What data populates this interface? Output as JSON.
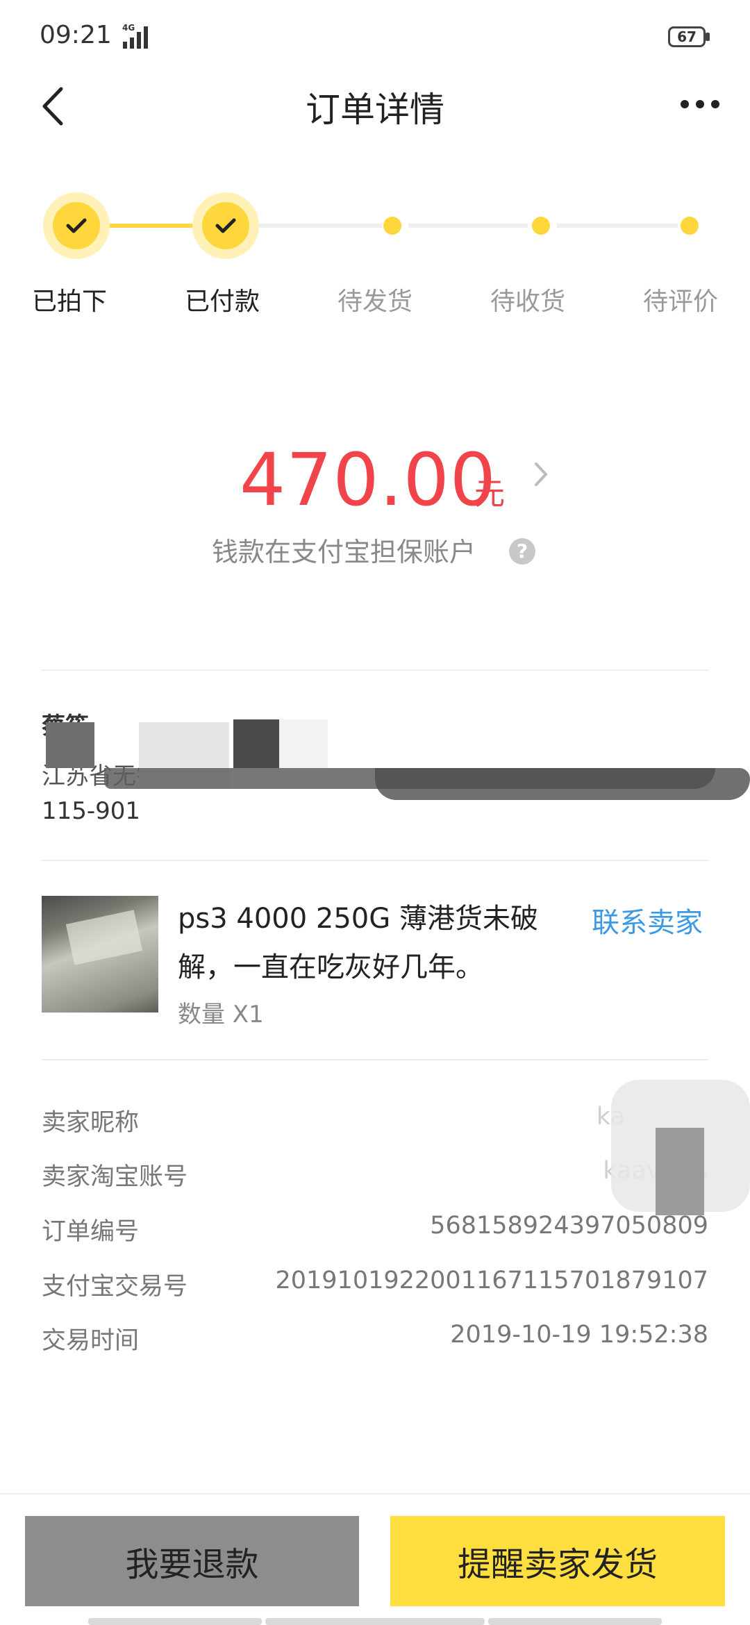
{
  "status_bar": {
    "time": "09:21",
    "network": "4G",
    "battery": "67"
  },
  "header": {
    "title": "订单详情"
  },
  "progress": {
    "current_step": 2,
    "steps": [
      {
        "label": "已拍下",
        "done": true
      },
      {
        "label": "已付款",
        "done": true
      },
      {
        "label": "待发货",
        "done": false
      },
      {
        "label": "待收货",
        "done": false
      },
      {
        "label": "待评价",
        "done": false
      }
    ]
  },
  "amount": {
    "value": "470.00",
    "unit": "元",
    "note": "钱款在支付宝担保账户",
    "help": "?"
  },
  "address": {
    "name": "蔡筱",
    "line1": "江苏省无锡市",
    "line2": "115-901"
  },
  "product": {
    "title": "ps3 4000 250G 薄港货未破解，一直在吃灰好几年。",
    "quantity": "数量 X1",
    "contact_label": "联系卖家"
  },
  "order_info": {
    "rows": [
      {
        "label": "卖家昵称",
        "value": "ka"
      },
      {
        "label": "卖家淘宝账号",
        "value": "kaavinss"
      },
      {
        "label": "订单编号",
        "value": "568158924397050809"
      },
      {
        "label": "支付宝交易号",
        "value": "2019101922001167115701879107"
      },
      {
        "label": "交易时间",
        "value": "2019-10-19 19:52:38"
      }
    ]
  },
  "actions": {
    "refund": "我要退款",
    "remind": "提醒卖家发货"
  },
  "colors": {
    "accent": "#ffd73c",
    "price": "#f0444a",
    "link": "#3c99e6",
    "refund_button": "#8d8d8f"
  }
}
